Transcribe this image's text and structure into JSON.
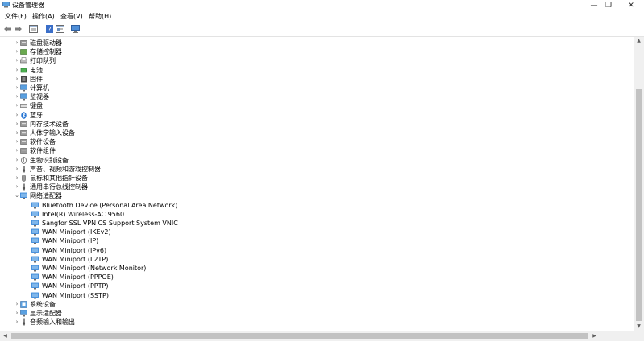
{
  "window": {
    "title": "设备管理器",
    "minimize_icon": "minimize-icon",
    "maximize_icon": "restore-icon",
    "close_icon": "close-icon",
    "minimize_glyph": "—",
    "maximize_glyph": "❐",
    "close_glyph": "✕"
  },
  "menu": [
    "文件(F)",
    "操作(A)",
    "查看(V)",
    "帮助(H)"
  ],
  "toolbar": {
    "back": "back-arrow-icon",
    "forward": "forward-arrow-icon",
    "properties": "properties-icon",
    "help": "help-icon",
    "update": "update-driver-icon",
    "scan": "scan-hardware-icon"
  },
  "tree": {
    "categories_top": [
      {
        "label": "磁盘驱动器",
        "icon": "disk-drive-icon"
      },
      {
        "label": "存储控制器",
        "icon": "storage-controller-icon"
      },
      {
        "label": "打印队列",
        "icon": "printer-icon"
      },
      {
        "label": "电池",
        "icon": "battery-icon"
      },
      {
        "label": "固件",
        "icon": "firmware-icon"
      },
      {
        "label": "计算机",
        "icon": "computer-icon"
      },
      {
        "label": "监视器",
        "icon": "monitor-icon"
      },
      {
        "label": "键盘",
        "icon": "keyboard-icon"
      },
      {
        "label": "蓝牙",
        "icon": "bluetooth-icon"
      },
      {
        "label": "内存技术设备",
        "icon": "memory-device-icon"
      },
      {
        "label": "人体学输入设备",
        "icon": "hid-icon"
      },
      {
        "label": "软件设备",
        "icon": "software-device-icon"
      },
      {
        "label": "软件组件",
        "icon": "software-component-icon"
      },
      {
        "label": "生物识别设备",
        "icon": "biometric-icon"
      },
      {
        "label": "声音、视频和游戏控制器",
        "icon": "sound-icon"
      },
      {
        "label": "鼠标和其他指针设备",
        "icon": "mouse-icon"
      },
      {
        "label": "通用串行总线控制器",
        "icon": "usb-icon"
      }
    ],
    "expanded": {
      "label": "网络适配器",
      "icon": "network-adapter-icon"
    },
    "children": [
      "Bluetooth Device (Personal Area Network)",
      "Intel(R) Wireless-AC 9560",
      "Sangfor SSL VPN CS Support System VNIC",
      "WAN Miniport (IKEv2)",
      "WAN Miniport (IP)",
      "WAN Miniport (IPv6)",
      "WAN Miniport (L2TP)",
      "WAN Miniport (Network Monitor)",
      "WAN Miniport (PPPOE)",
      "WAN Miniport (PPTP)",
      "WAN Miniport (SSTP)"
    ],
    "categories_bottom": [
      {
        "label": "系统设备",
        "icon": "system-device-icon"
      },
      {
        "label": "显示适配器",
        "icon": "display-adapter-icon"
      },
      {
        "label": "音频输入和输出",
        "icon": "audio-io-icon"
      }
    ],
    "collapsed_glyph": "›",
    "expanded_glyph": "⌄"
  },
  "colors": {
    "accent": "#2b7fd6",
    "icon_gray": "#6b6b6b"
  }
}
